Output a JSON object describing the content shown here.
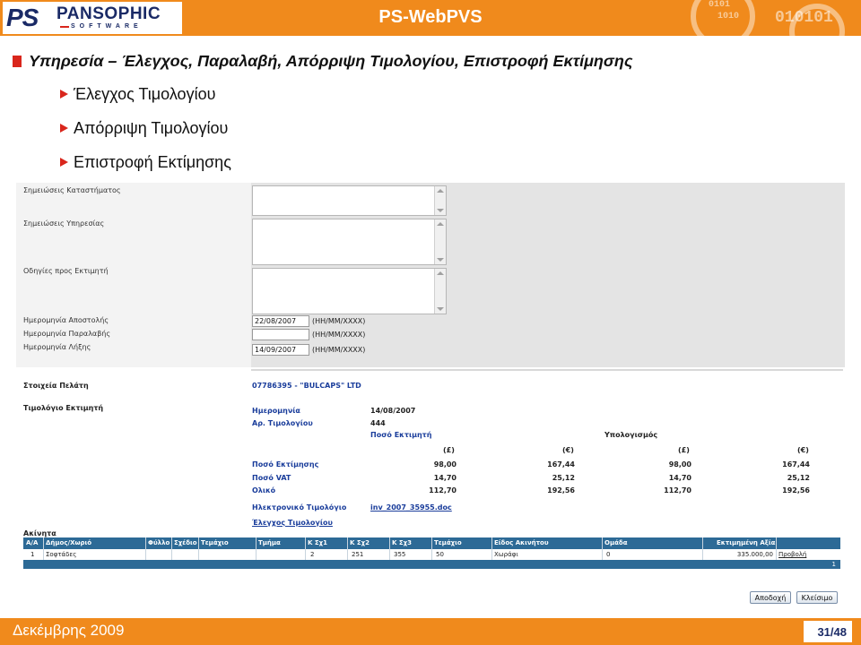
{
  "banner": {
    "logo_ps": "PS",
    "logo_name": "PANSOPHIC",
    "logo_sub": "SOFTWARE",
    "title": "PS-WebPVS",
    "deco_binary": [
      "0101",
      "1010",
      "010101"
    ],
    "colors": {
      "brand_orange": "#f08a1c",
      "logo_navy": "#1a2a66",
      "accent_red": "#d9261c"
    }
  },
  "heading": {
    "title": "Υπηρεσία – Έλεγχος, Παραλαβή, Απόρριψη Τιμολογίου, Επιστροφή Εκτίμησης",
    "items": [
      "Έλεγχος Τιμολογίου",
      "Απόρριψη Τιμολογίου",
      "Επιστροφή Εκτίμησης"
    ]
  },
  "form": {
    "notes_store_label": "Σημειώσεις Καταστήματος",
    "notes_service_label": "Σημειώσεις Υπηρεσίας",
    "instructions_label": "Οδηγίες προς Εκτιμητή",
    "send_date_label": "Ημερομηνία Αποστολής",
    "send_date_value": "22/08/2007",
    "receive_date_label": "Ημερομηνία Παραλαβής",
    "receive_date_value": "",
    "expiry_date_label": "Ημερομηνία Λήξης",
    "expiry_date_value": "14/09/2007",
    "date_hint": "(HH/MM/XXXX)"
  },
  "customer": {
    "label": "Στοιχεία Πελάτη",
    "value": "07786395 - \"BULCAPS\" LTD"
  },
  "invoice": {
    "section_label": "Τιμολόγιο Εκτιμητή",
    "date_label": "Ημερομηνία",
    "date_value": "14/08/2007",
    "number_label": "Αρ. Τιμολογίου",
    "number_value": "444",
    "amount_label": "Ποσό Εκτιμητή",
    "calc_label": "Υπολογισμός",
    "currency_gbp": "(£)",
    "currency_eur": "(€)",
    "rows": [
      {
        "label": "Ποσό Εκτίμησης",
        "gbp": "98,00",
        "eur": "167,44",
        "calc_gbp": "98,00",
        "calc_eur": "167,44"
      },
      {
        "label": "Ποσό VAT",
        "gbp": "14,70",
        "eur": "25,12",
        "calc_gbp": "14,70",
        "calc_eur": "25,12"
      },
      {
        "label": "Ολικό",
        "gbp": "112,70",
        "eur": "192,56",
        "calc_gbp": "112,70",
        "calc_eur": "192,56"
      }
    ],
    "electronic_label": "Ηλεκτρονικό Τιμολόγιο",
    "electronic_file": "inv_2007_35955.doc",
    "check_link": "Έλεγχος Τιμολογίου"
  },
  "property": {
    "title": "Ακίνητα",
    "columns": [
      "Α/Α",
      "Δήμος/Χωριό",
      "Φύλλο",
      "Σχέδιο",
      "Τεμάχιο",
      "Τμήμα",
      "Κ Σχ1",
      "Κ Σχ2",
      "Κ Σχ3",
      "Τεμάχιο",
      "Είδος Ακινήτου",
      "Ομάδα",
      "Εκτιμημένη Αξία"
    ],
    "rows": [
      {
        "aa": "1",
        "village": "Σοφτάδες",
        "sheet": "",
        "plan": "",
        "plot": "",
        "block": "",
        "k1": "2",
        "k2": "251",
        "k3": "355",
        "plot2": "50",
        "type": "Χωράφι",
        "group": "0",
        "value": "335.000,00",
        "action": "Προβολή"
      }
    ],
    "page": "1"
  },
  "buttons": {
    "accept": "Αποδοχή",
    "close": "Κλείσιμο"
  },
  "footer": {
    "date": "Δεκέμβρης 2009",
    "page": "31/48"
  }
}
